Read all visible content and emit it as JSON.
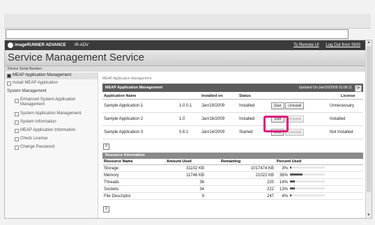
{
  "browser": {
    "address_value": ""
  },
  "topbar": {
    "brand": "imageRUNNER ADVANCE",
    "model": "iR-ADV",
    "links": [
      "To Remote UI",
      "Log Out from SMS"
    ]
  },
  "title": "Service Management Service",
  "device_serial_label": "Device Serial Number :",
  "sidebar": {
    "items": [
      {
        "label": "MEAP Application Management"
      },
      {
        "label": "Install MEAP Application"
      },
      {
        "label": "System Management"
      },
      {
        "label": "Enhanced System Application Management"
      },
      {
        "label": "System Application Management"
      },
      {
        "label": "System Information"
      },
      {
        "label": "MEAP Application Information"
      },
      {
        "label": "Check License"
      },
      {
        "label": "Change Password"
      }
    ]
  },
  "breadcrumb": "MEAP Application Management",
  "apps_panel": {
    "title": "MEAP Application Management",
    "updated": "Updated On:Jan/16/2009 01:06:11"
  },
  "apps_columns": [
    "Application Name",
    "",
    "Installed on",
    "Status",
    "",
    "License"
  ],
  "apps": [
    {
      "name": "Sample Application 1",
      "version": "1.0.0.1",
      "installed_on": "Jan/19/2009",
      "status": "Installed",
      "action": "Start",
      "action2": "Uninstall",
      "license": "Unnecessary"
    },
    {
      "name": "Sample Application 2",
      "version": "1.0",
      "installed_on": "Jan/16/2009",
      "status": "Installed",
      "action": "Start",
      "action2": "Uninstall",
      "license": "Installed"
    },
    {
      "name": "Sample Application 3",
      "version": "0.6.1",
      "installed_on": "Jan/14/2009",
      "status": "Started",
      "action": "Stop",
      "action2": "Uninstall",
      "license": "Not Installed"
    }
  ],
  "resource_panel": {
    "title": "Resource Information"
  },
  "res_columns": [
    "Resource Name",
    "Amount Used",
    "Remaining",
    "Percent Used"
  ],
  "resources": [
    {
      "name": "Storage",
      "used": "31102 KB",
      "remaining": "1017474 KB",
      "percent": "3%",
      "fraction": 0.03
    },
    {
      "name": "Memory",
      "used": "11746 KB",
      "remaining": "21022 KB",
      "percent": "36%",
      "fraction": 0.36
    },
    {
      "name": "Threads",
      "used": "36",
      "remaining": "220",
      "percent": "14%",
      "fraction": 0.14
    },
    {
      "name": "Sockets",
      "used": "34",
      "remaining": "222",
      "percent": "13%",
      "fraction": 0.13
    },
    {
      "name": "File Descriptor",
      "used": "9",
      "remaining": "247",
      "percent": "4%",
      "fraction": 0.04
    }
  ],
  "accent": "#e0147b"
}
